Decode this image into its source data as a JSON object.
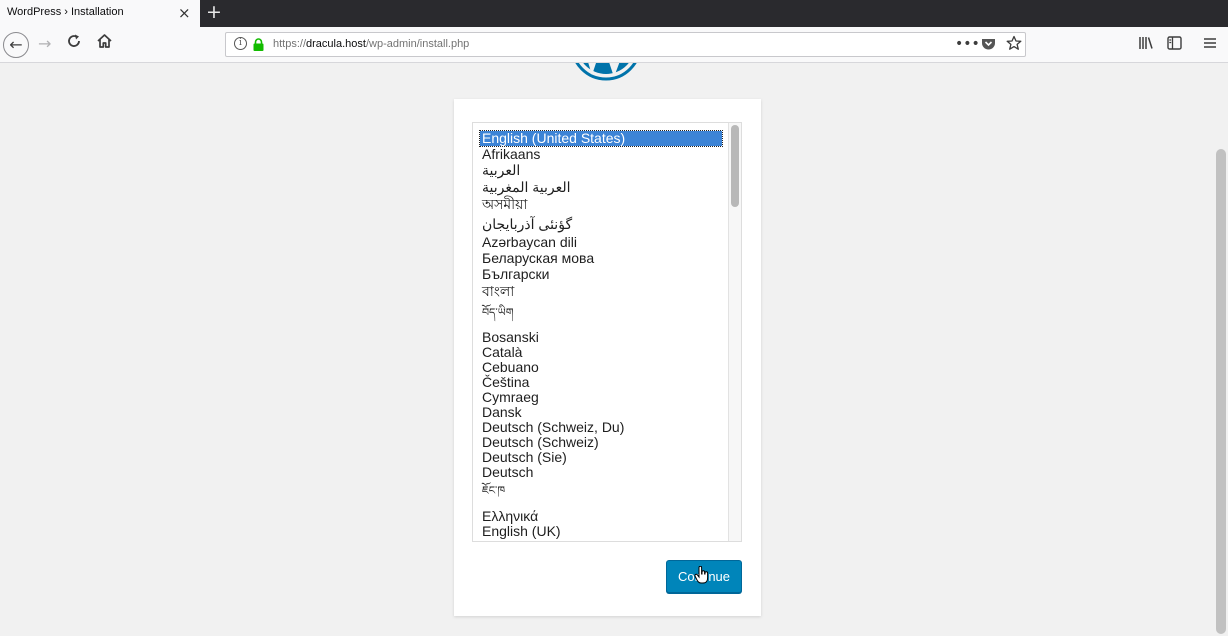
{
  "browser": {
    "tab_title": "WordPress › Installation",
    "tab_close_glyph": "×",
    "new_tab_glyph": "+",
    "url_scheme": "https://",
    "url_host": "dracula.host",
    "url_path": "/wp-admin/install.php",
    "icons": [
      "back-icon",
      "forward-icon",
      "reload-icon",
      "home-icon",
      "info-icon",
      "lock-icon",
      "page-actions-icon",
      "pocket-icon",
      "bookmark-star-icon",
      "library-icon",
      "sidebar-icon",
      "menu-icon"
    ]
  },
  "installer": {
    "languages": [
      "English (United States)",
      "Afrikaans",
      "العربية",
      "العربية المغربية",
      "অসমীয়া",
      "گؤنئی آذربایجان",
      "Azərbaycan dili",
      "Беларуская мова",
      "Български",
      "বাংলা",
      "བོད་ཡིག",
      "Bosanski",
      "Català",
      "Cebuano",
      "Čeština",
      "Cymraeg",
      "Dansk",
      "Deutsch (Schweiz, Du)",
      "Deutsch (Schweiz)",
      "Deutsch (Sie)",
      "Deutsch",
      "ཇོང་ཁ",
      "Ελληνικά",
      "English (UK)"
    ],
    "selected_language": "English (United States)",
    "continue_label": "Continue",
    "accent_color": "#0085ba",
    "selection_color": "#3d84d6"
  }
}
